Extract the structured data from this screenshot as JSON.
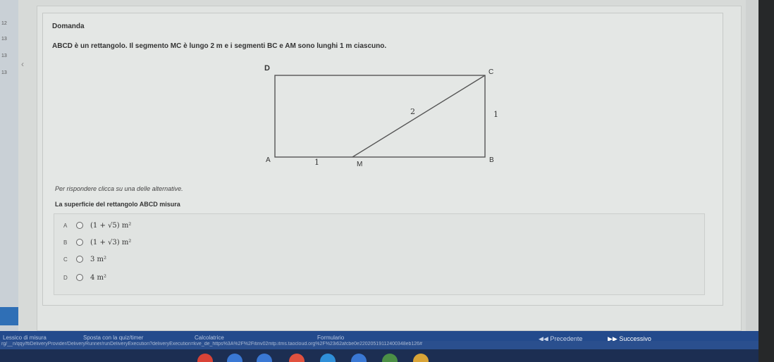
{
  "sidebar": {
    "items": [
      "12",
      "13",
      "13",
      "13"
    ]
  },
  "question": {
    "heading": "Domanda",
    "text": "ABCD è un rettangolo. Il segmento MC è lungo 2 m e i segmenti BC e AM sono lunghi 1 m ciascuno.",
    "instruction": "Per rispondere clicca su una delle alternative.",
    "prompt": "La superficie del rettangolo ABCD misura"
  },
  "figure": {
    "vertices": {
      "a": "A",
      "b": "B",
      "c": "C",
      "d": "D",
      "m": "M"
    },
    "measures": {
      "mc": "2",
      "bc": "1",
      "am": "1"
    }
  },
  "options": [
    {
      "letter": "A",
      "text": "(1 + √5) m²"
    },
    {
      "letter": "B",
      "text": "(1 + √3) m²"
    },
    {
      "letter": "C",
      "text": "3 m²"
    },
    {
      "letter": "D",
      "text": "4 m²"
    }
  ],
  "footer": {
    "tools": [
      "Lessico di misura",
      "Sposta con la quiz/timer",
      "Calcolatrice",
      "Formulario"
    ],
    "prev_label": "Precedente",
    "next_label": "Successivo"
  },
  "status": {
    "url": "rg/__n/qqy/ftiDeliveryProvider/DeliveryRunner/runDeliveryExecution?deliveryExecution=kve_de_https%3A%2F%2Fitinv02mtp.itms.taocloud.org%2F%23i62afcbe0e22020519112400348eb126#"
  },
  "colors": {
    "footer_blue": "#234a8c",
    "accent_blue": "#2f6fb6"
  }
}
